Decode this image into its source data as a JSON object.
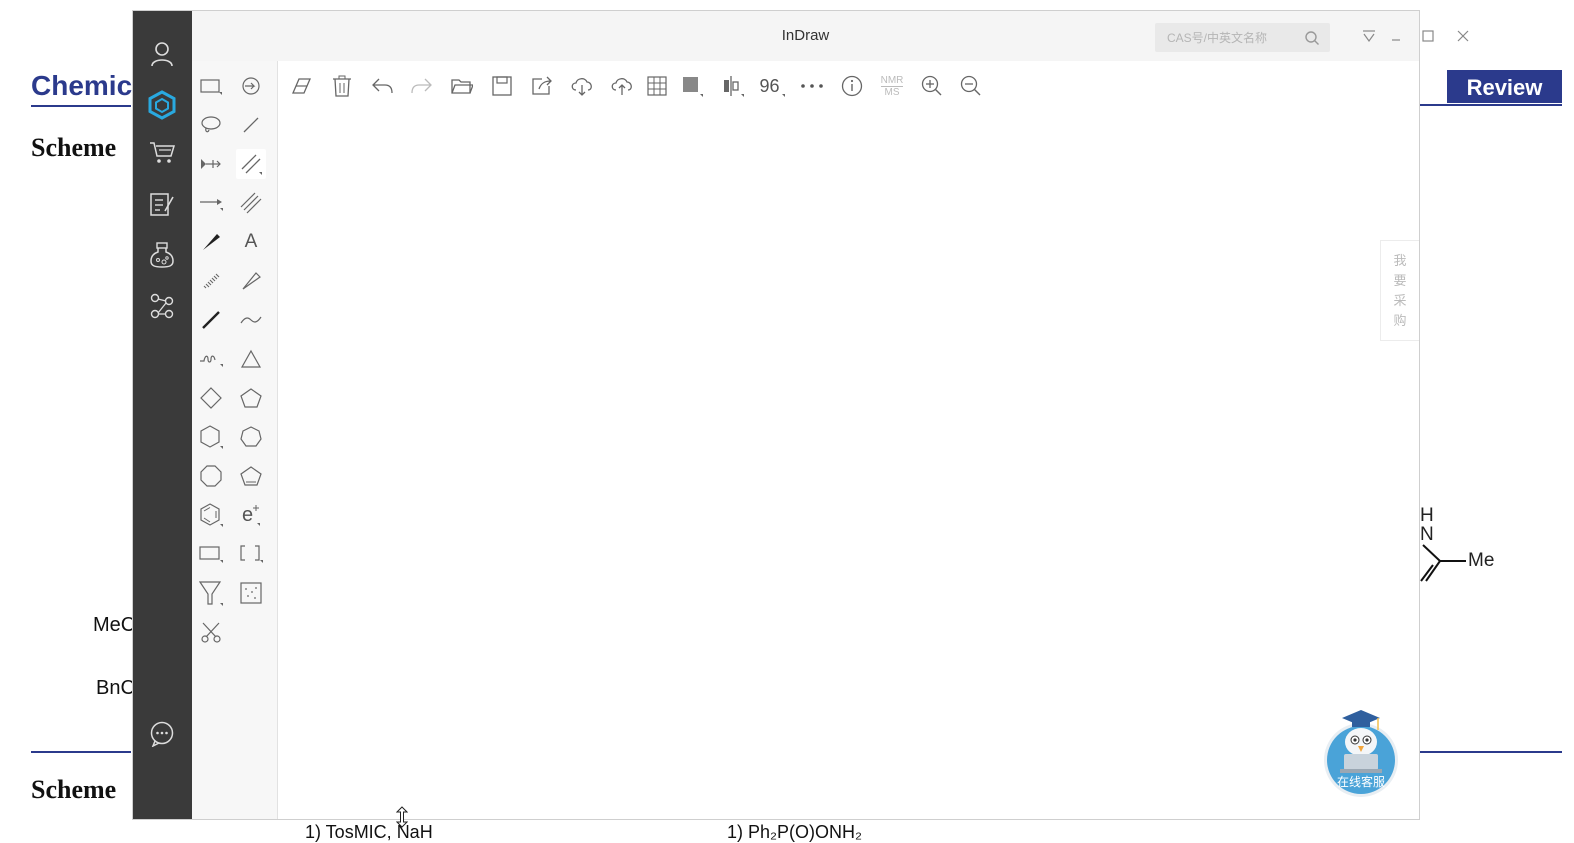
{
  "background_doc": {
    "title_fragment": "Chemica",
    "review_badge": "Review",
    "scheme_top": "Scheme",
    "scheme_bottom": "Scheme",
    "label_meo": "MeC",
    "label_bno": "BnC",
    "reagent_1": "1) TosMIC, NaH",
    "reagent_2": "1) Ph₂P(O)ONH₂",
    "mol_h": "H",
    "mol_n": "N",
    "mol_me": "Me"
  },
  "window": {
    "title": "InDraw",
    "search_placeholder": "CAS号/中英文名称"
  },
  "sidebar": {
    "items": [
      {
        "name": "user-icon"
      },
      {
        "name": "indraw-logo-icon",
        "active": true
      },
      {
        "name": "cart-icon"
      },
      {
        "name": "notes-icon"
      },
      {
        "name": "flask-icon"
      },
      {
        "name": "network-icon"
      },
      {
        "name": "chat-icon"
      }
    ]
  },
  "toolbar": {
    "zoom_value": "96",
    "nmr_label_top": "NMR",
    "nmr_label_bottom": "MS"
  },
  "tools": {
    "text_tool": "A",
    "charge_tool": "e"
  },
  "buy_tab": [
    "我",
    "要",
    "采",
    "购"
  ],
  "customer_service": {
    "label": "在线客服"
  },
  "colors": {
    "sidebar_bg": "#3a3a3a",
    "accent": "#29a9e0",
    "doc_blue": "#2b3a8c"
  }
}
